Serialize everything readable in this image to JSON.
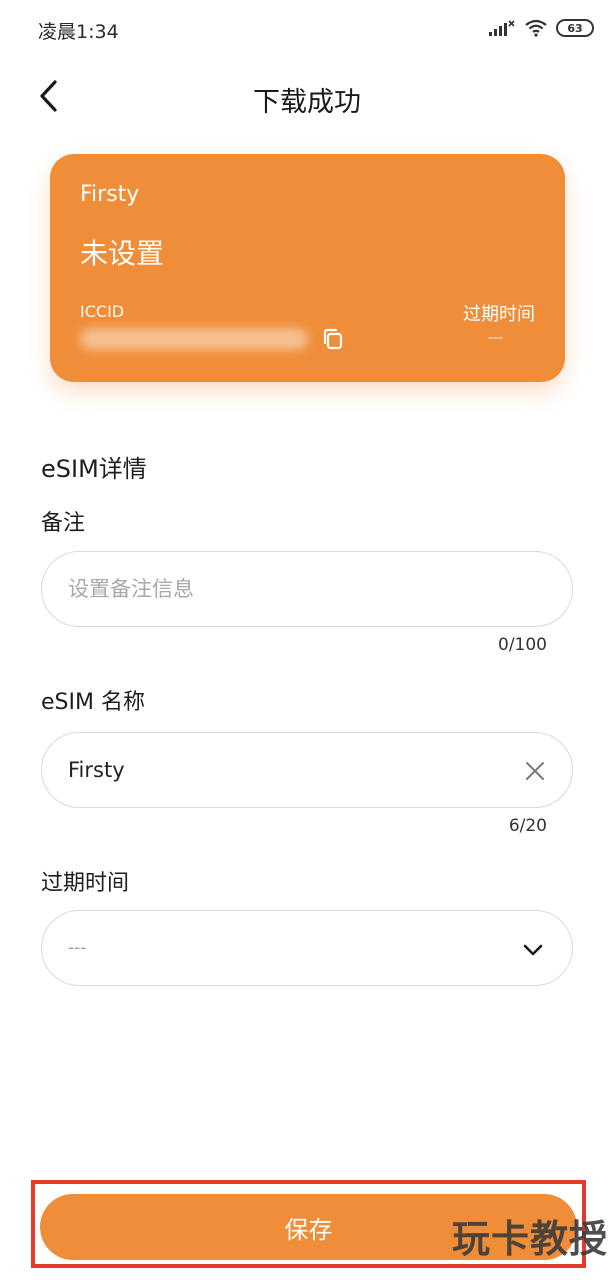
{
  "status_bar": {
    "time": "凌晨1:34",
    "battery": "63"
  },
  "header": {
    "title": "下载成功",
    "back_icon": "chevron-left-icon"
  },
  "card": {
    "brand": "Firsty",
    "status": "未设置",
    "iccid_label": "ICCID",
    "expire_label": "过期时间",
    "expire_value": "---",
    "accent_color": "#ef8d38"
  },
  "details": {
    "section_title": "eSIM详情",
    "note": {
      "label": "备注",
      "placeholder": "设置备注信息",
      "value": "",
      "counter": "0/100"
    },
    "name": {
      "label": "eSIM 名称",
      "value": "Firsty",
      "counter": "6/20"
    },
    "expiry": {
      "label": "过期时间",
      "value": "---"
    }
  },
  "footer": {
    "save_label": "保存",
    "highlight_color": "#e53b2c"
  },
  "watermark": "玩卡教授"
}
